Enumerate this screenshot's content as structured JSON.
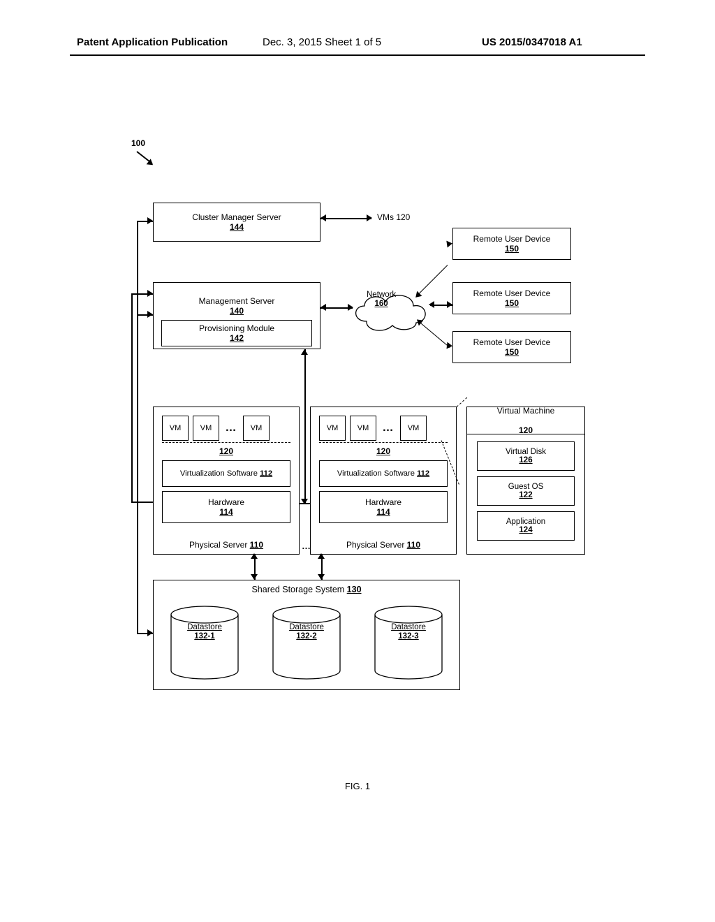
{
  "header": {
    "left": "Patent Application Publication",
    "center": "Dec. 3, 2015   Sheet 1 of 5",
    "right": "US 2015/0347018 A1"
  },
  "ref100": "100",
  "cluster_mgr": {
    "label": "Cluster Manager Server",
    "num": "144"
  },
  "vms_label": "VMs 120",
  "mgmt": {
    "label": "Management Server",
    "num": "140"
  },
  "prov": {
    "label": "Provisioning Module",
    "num": "142"
  },
  "network": {
    "label": "Network",
    "num": "160"
  },
  "rud": {
    "label": "Remote User Device",
    "num": "150"
  },
  "ps": {
    "vm": "VM",
    "vm120": "120",
    "virt": "Virtualization Software",
    "virt_num": "112",
    "hw": "Hardware",
    "hw_num": "114",
    "caption": "Physical Server",
    "caption_num": "110",
    "ellipsis": "…"
  },
  "between_ps": "…",
  "vm_detail": {
    "top": "Virtual Machine",
    "top_num": "120",
    "disk": "Virtual Disk",
    "disk_num": "126",
    "gos": "Guest OS",
    "gos_num": "122",
    "app": "Application",
    "app_num": "124"
  },
  "storage": {
    "title": "Shared Storage System",
    "title_num": "130",
    "ds_label": "Datastore",
    "ds1": "132-1",
    "ds2": "132-2",
    "ds3": "132-3"
  },
  "fig": "FIG. 1"
}
